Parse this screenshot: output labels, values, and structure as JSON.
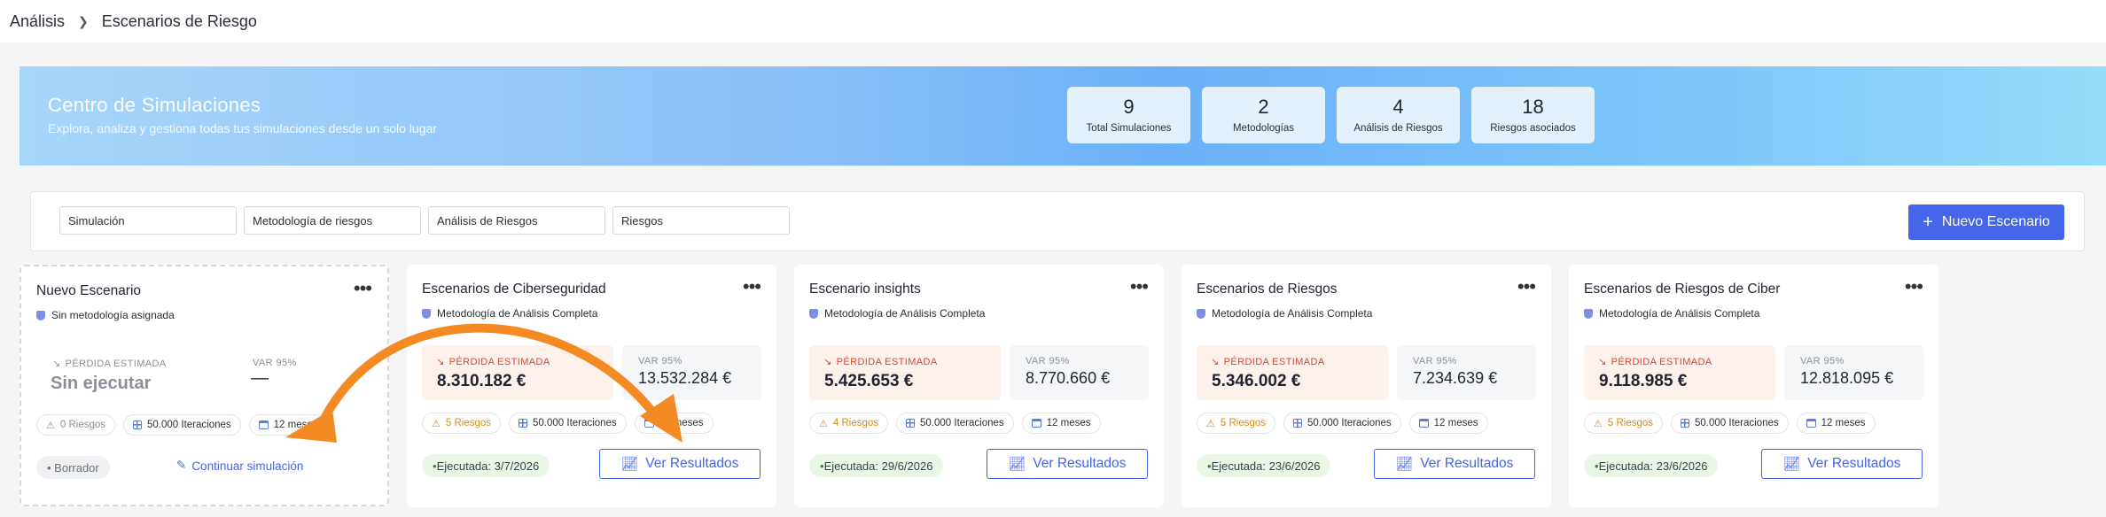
{
  "breadcrumb": {
    "root": "Análisis",
    "current": "Escenarios de Riesgo"
  },
  "hero": {
    "title": "Centro de Simulaciones",
    "subtitle": "Explora, analiza y gestiona todas tus simulaciones desde un solo lugar",
    "stats": [
      {
        "value": "9",
        "label": "Total Simulaciones"
      },
      {
        "value": "2",
        "label": "Metodologías"
      },
      {
        "value": "4",
        "label": "Análisis de Riesgos"
      },
      {
        "value": "18",
        "label": "Riesgos asociados"
      }
    ]
  },
  "filters": {
    "simulation": "Simulación",
    "methodology": "Metodología de riesgos",
    "analysis": "Análisis de Riesgos",
    "risks": "Riesgos",
    "new_button": "Nuevo Escenario"
  },
  "draft_card": {
    "title": "Nuevo Escenario",
    "methodology": "Sin metodología asignada",
    "loss_label": "PÉRDIDA ESTIMADA",
    "loss_value": "Sin ejecutar",
    "var_label": "VAR 95%",
    "var_value": "—",
    "risks": "0 Riesgos",
    "iterations": "50.000 Iteraciones",
    "months": "12 meses",
    "status": "• Borrador",
    "action": "Continuar simulación"
  },
  "cards": [
    {
      "title": "Escenarios de Ciberseguridad",
      "methodology": "Metodología de Análisis Completa",
      "loss_label": "PÉRDIDA ESTIMADA",
      "loss_value": "8.310.182 €",
      "var_label": "VAR 95%",
      "var_value": "13.532.284 €",
      "risks": "5 Riesgos",
      "iterations": "50.000 Iteraciones",
      "months": "12 meses",
      "status_prefix": "• ",
      "status": "Ejecutada: 3/7/2026",
      "action": "Ver Resultados"
    },
    {
      "title": "Escenario insights",
      "methodology": "Metodología de Análisis Completa",
      "loss_label": "PÉRDIDA ESTIMADA",
      "loss_value": "5.425.653 €",
      "var_label": "VAR 95%",
      "var_value": "8.770.660 €",
      "risks": "4 Riesgos",
      "iterations": "50.000 Iteraciones",
      "months": "12 meses",
      "status_prefix": "• ",
      "status": "Ejecutada: 29/6/2026",
      "action": "Ver Resultados"
    },
    {
      "title": "Escenarios de Riesgos",
      "methodology": "Metodología de Análisis Completa",
      "loss_label": "PÉRDIDA ESTIMADA",
      "loss_value": "5.346.002 €",
      "var_label": "VAR 95%",
      "var_value": "7.234.639 €",
      "risks": "5 Riesgos",
      "iterations": "50.000 Iteraciones",
      "months": "12 meses",
      "status_prefix": "• ",
      "status": "Ejecutada: 23/6/2026",
      "action": "Ver Resultados"
    },
    {
      "title": "Escenarios de Riesgos de Ciber",
      "methodology": "Metodología de Análisis Completa",
      "loss_label": "PÉRDIDA ESTIMADA",
      "loss_value": "9.118.985 €",
      "var_label": "VAR 95%",
      "var_value": "12.818.095 €",
      "risks": "5 Riesgos",
      "iterations": "50.000 Iteraciones",
      "months": "12 meses",
      "status_prefix": "• ",
      "status": "Ejecutada: 23/6/2026",
      "action": "Ver Resultados"
    }
  ],
  "colors": {
    "accent": "#4566e8",
    "annotation_arrow": "#f48a24",
    "loss": "#d34a2c",
    "success": "#2f8a3b"
  },
  "icons": {
    "more": "more-horizontal-icon",
    "method": "shield-icon",
    "trend": "trending-down-icon",
    "chart": "line-chart-icon",
    "edit": "pencil-icon",
    "plus": "plus-icon"
  }
}
